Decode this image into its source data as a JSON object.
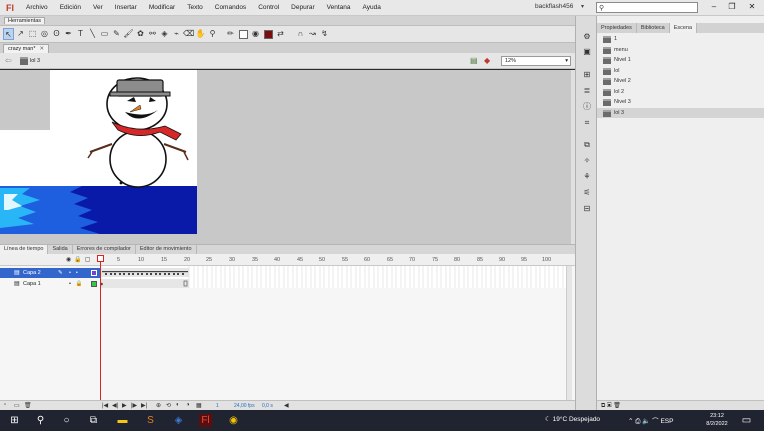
{
  "app": {
    "logo": "Fl",
    "account": "backflash456",
    "search_placeholder": ""
  },
  "menu": [
    "Archivo",
    "Edición",
    "Ver",
    "Insertar",
    "Modificar",
    "Texto",
    "Comandos",
    "Control",
    "Depurar",
    "Ventana",
    "Ayuda"
  ],
  "tools_panel_title": "Herramientas",
  "document_tab": "crazy man*",
  "editbar": {
    "scene_label": "lol 3",
    "zoom": "12%"
  },
  "timeline": {
    "tabs": [
      "Línea de tiempo",
      "Salida",
      "Errores de compilador",
      "Editor de movimiento"
    ],
    "ruler": [
      "1",
      "5",
      "10",
      "15",
      "20",
      "25",
      "30",
      "35",
      "40",
      "45",
      "50",
      "55",
      "60",
      "65",
      "70",
      "75",
      "80",
      "85",
      "90",
      "95",
      "100"
    ],
    "layers": [
      {
        "name": "Capa 2",
        "selected": true
      },
      {
        "name": "Capa 1",
        "selected": false
      }
    ],
    "fps": "24,00 fps",
    "elapsed": "0,0 s",
    "current_frame": "1"
  },
  "right_panel": {
    "tabs": [
      "Propiedades",
      "Biblioteca",
      "Escena"
    ],
    "active_tab": "Escena",
    "scenes": [
      "1",
      "menu",
      "Nivel 1",
      "lol",
      "Nivel 2",
      "lol 2",
      "Nivel 3",
      "lol 3"
    ],
    "selected_scene": "lol 3"
  },
  "taskbar": {
    "weather": "19°C  Despejado",
    "language": "ESP",
    "time": "23:12",
    "date": "8/2/2022"
  },
  "colors": {
    "accent_red": "#d22222",
    "stroke_color": "#222222",
    "fill_color": "#7a0d0d",
    "selection_blue": "#3366cc",
    "taskbar_bg": "#1f2430"
  }
}
